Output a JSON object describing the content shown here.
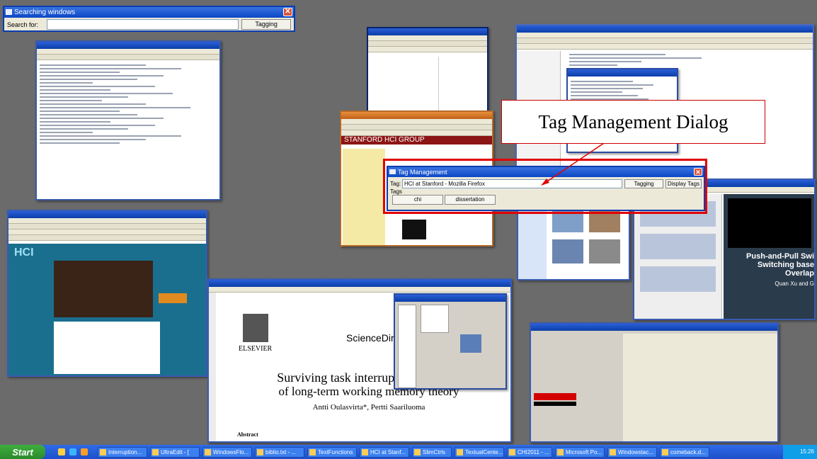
{
  "search_window": {
    "title": "Searching windows",
    "label": "Search for:",
    "value": "",
    "button": "Tagging"
  },
  "tag_dialog": {
    "title": "Tag Management",
    "tag_label": "Tag:",
    "tag_value": "HCI at Stanford - Mozilla Firefox",
    "tagging_button": "Tagging",
    "display_button": "Display Tags",
    "tags_label": "Tags",
    "tags": [
      "chi",
      "dissertation"
    ]
  },
  "annotation": {
    "text": "Tag Management Dialog"
  },
  "thumbnails": {
    "stanford_banner": "STANFORD HCI GROUP",
    "hci_logo": "HCI",
    "paper_science_direct": "ScienceDirect",
    "paper_elsevier": "ELSEVIER",
    "paper_title_1": "Surviving task interruptions: Investi",
    "paper_title_2": "of long-term working memory theory",
    "paper_authors": "Antti Oulasvirta*, Pertti Saariluoma",
    "paper_abstract": "Abstract",
    "slide_title_1": "Push-and-Pull Swi",
    "slide_title_2": "Switching base",
    "slide_title_3": "Overlap",
    "slide_author": "Quan Xu and G"
  },
  "taskbar": {
    "start": "Start",
    "tasks": [
      "Interruption...",
      "UltraEdit - [",
      "WindowsFlo...",
      "biblio.txt - ...",
      "TextFunctions",
      "HCI at Stanf...",
      "SlimCtrls",
      "TextualCente...",
      "CHI2011 - ...",
      "Microsoft Po...",
      "Windowstac...",
      "comeback.d..."
    ],
    "clock": "15:26"
  },
  "colors": {
    "accent": "#0b47c6",
    "annotation": "#e00000",
    "taskbar": "#2f6be8"
  }
}
